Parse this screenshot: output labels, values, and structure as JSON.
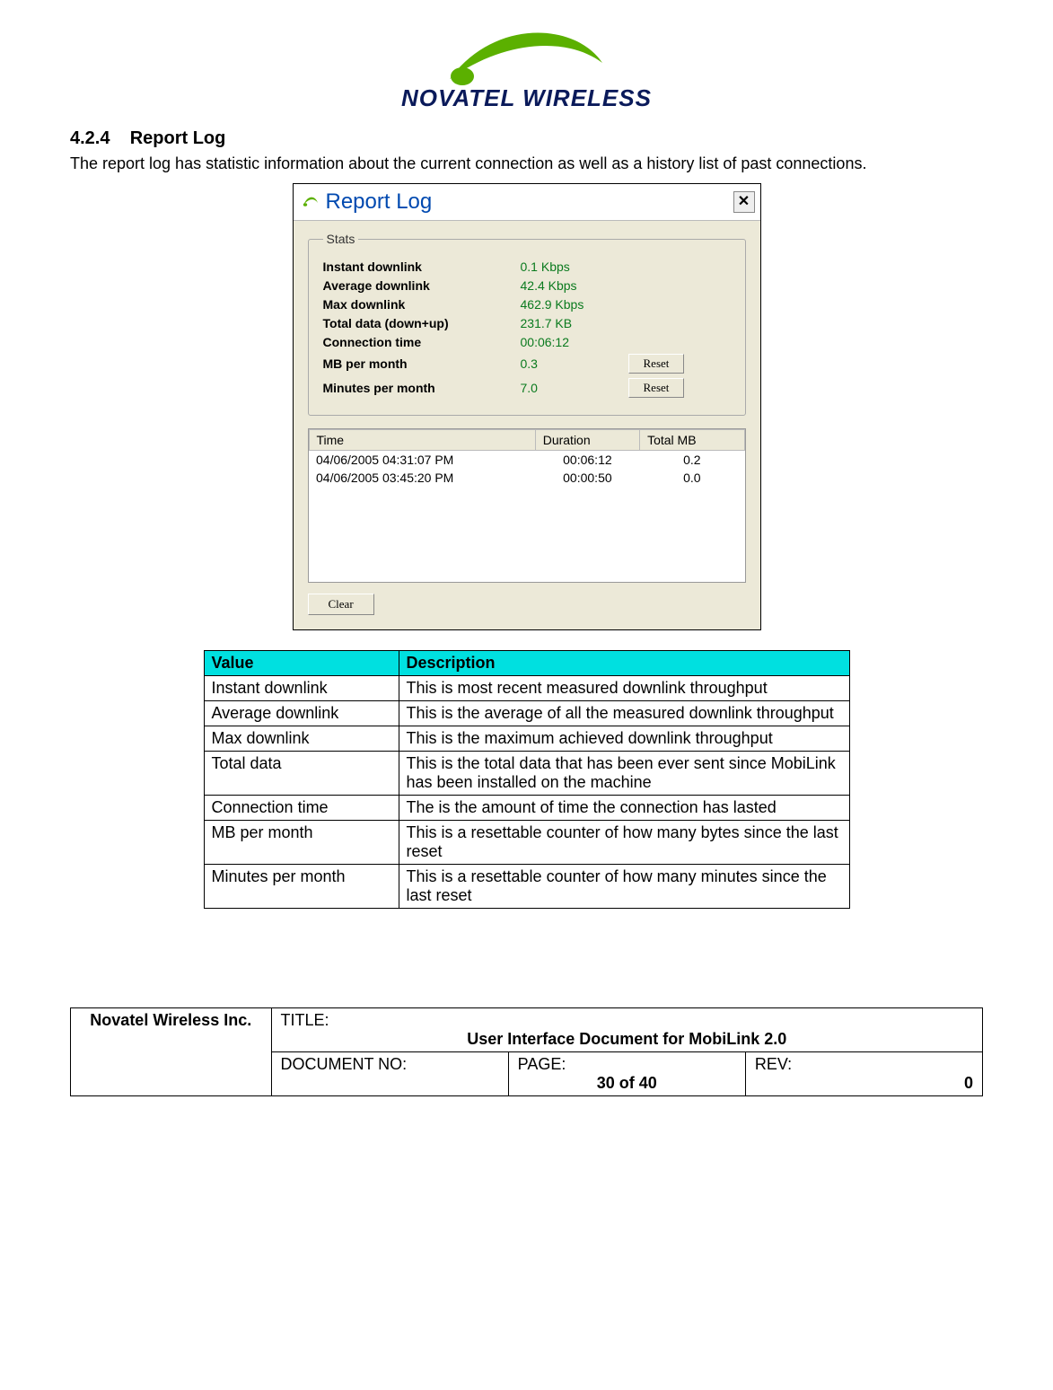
{
  "logo_text": "NOVATEL WIRELESS",
  "section_number": "4.2.4",
  "section_title": "Report Log",
  "intro": "The report log has statistic information about the current connection as well as a history list of past connections.",
  "window": {
    "title": "Report Log",
    "close": "✕",
    "stats_legend": "Stats",
    "labels": {
      "instant": "Instant downlink",
      "average": "Average downlink",
      "max": "Max downlink",
      "total": "Total data (down+up)",
      "conn": "Connection time",
      "mb": "MB per month",
      "min": "Minutes per month"
    },
    "values": {
      "instant": "0.1 Kbps",
      "average": "42.4 Kbps",
      "max": "462.9 Kbps",
      "total": "231.7 KB",
      "conn": "00:06:12",
      "mb": "0.3",
      "min": "7.0"
    },
    "reset_label": "Reset",
    "history_headers": {
      "time": "Time",
      "duration": "Duration",
      "total_mb": "Total MB"
    },
    "history": [
      {
        "time": "04/06/2005 04:31:07 PM",
        "duration": "00:06:12",
        "total_mb": "0.2"
      },
      {
        "time": "04/06/2005 03:45:20 PM",
        "duration": "00:00:50",
        "total_mb": "0.0"
      }
    ],
    "clear_label": "Clear"
  },
  "table": {
    "head_value": "Value",
    "head_desc": "Description",
    "rows": [
      {
        "v": "Instant downlink",
        "d": "This is most recent measured downlink throughput"
      },
      {
        "v": "Average downlink",
        "d": "This is the average of all the measured downlink throughput"
      },
      {
        "v": "Max downlink",
        "d": "This is the maximum achieved downlink throughput"
      },
      {
        "v": "Total data",
        "d": "This is the total data that has been ever sent since MobiLink has been installed on the machine"
      },
      {
        "v": "Connection time",
        "d": "The is the amount of time the connection has lasted"
      },
      {
        "v": "MB per month",
        "d": "This is a resettable counter of how many bytes since the last reset"
      },
      {
        "v": "Minutes per month",
        "d": "This is a resettable counter of how many minutes since the last reset"
      }
    ]
  },
  "docblock": {
    "company": "Novatel Wireless Inc.",
    "title_label": "TITLE:",
    "title_value": "User Interface Document for MobiLink 2.0",
    "docno_label": "DOCUMENT NO:",
    "docno_value": "",
    "page_label": "PAGE:",
    "page_value": "30 of 40",
    "rev_label": "REV:",
    "rev_value": "0"
  }
}
